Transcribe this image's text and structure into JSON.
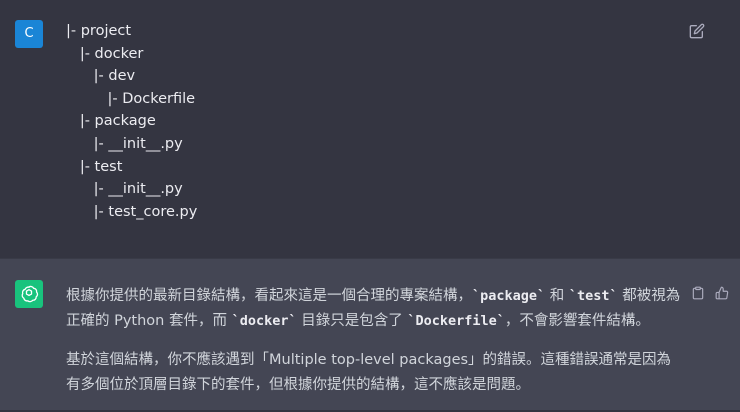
{
  "user_message": {
    "avatar_letter": "C",
    "tree_lines": [
      "|- project",
      "   |- docker",
      "      |- dev",
      "         |- Dockerfile",
      "   |- package",
      "      |- __init__.py",
      "   |- test",
      "      |- __init__.py",
      "      |- test_core.py"
    ]
  },
  "assistant_message": {
    "p1_a": "根據你提供的最新目錄結構，看起來這是一個合理的專案結構，",
    "p1_code1": "`package`",
    "p1_b": " 和 ",
    "p1_code2": "`test`",
    "p1_c": " 都被視為正確的 Python 套件，而 ",
    "p1_code3": "`docker`",
    "p1_d": " 目錄只是包含了 ",
    "p1_code4": "`Dockerfile`",
    "p1_e": "，不會影響套件結構。",
    "p2": "基於這個結構，你不應該遇到「Multiple top-level packages」的錯誤。這種錯誤通常是因為有多個位於頂層目錄下的套件，但根據你提供的結構，這不應該是問題。"
  },
  "colors": {
    "user_bg": "#343541",
    "assistant_bg": "#444654",
    "user_avatar": "#1a85d6",
    "gpt_avatar": "#19c37d"
  }
}
